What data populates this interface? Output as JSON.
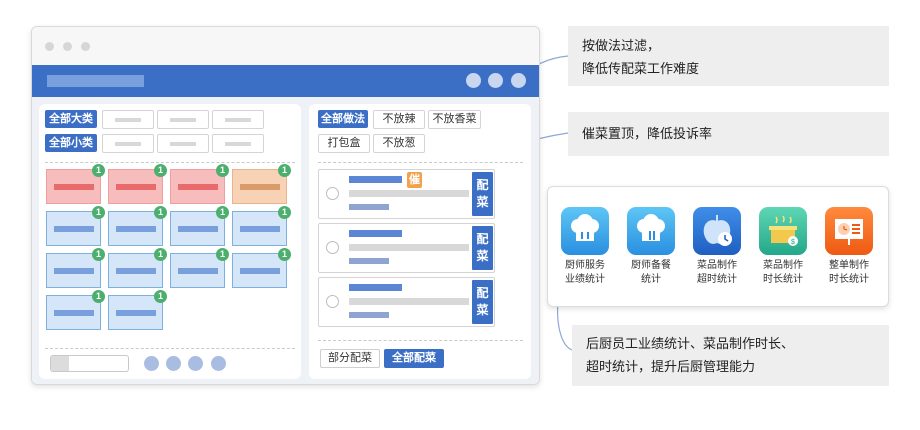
{
  "left_panel": {
    "category_all": "全部大类",
    "subcategory_all": "全部小类",
    "cards": [
      {
        "color": "red",
        "badge": "1"
      },
      {
        "color": "red",
        "badge": "1"
      },
      {
        "color": "red",
        "badge": "1"
      },
      {
        "color": "orange",
        "badge": "1"
      },
      {
        "color": "blue",
        "badge": "1"
      },
      {
        "color": "blue",
        "badge": "1"
      },
      {
        "color": "blue",
        "badge": "1"
      },
      {
        "color": "blue",
        "badge": "1"
      },
      {
        "color": "blue",
        "badge": "1"
      },
      {
        "color": "blue",
        "badge": "1"
      },
      {
        "color": "blue",
        "badge": "1"
      },
      {
        "color": "blue",
        "badge": "1"
      },
      {
        "color": "blue",
        "badge": "1"
      },
      {
        "color": "blue",
        "badge": "1"
      }
    ]
  },
  "right_panel": {
    "methods": [
      "全部做法",
      "不放辣",
      "不放香菜",
      "打包盒",
      "不放葱"
    ],
    "rush_tag": "催",
    "assign_label": "配菜",
    "partial_assign": "部分配菜",
    "assign_all": "全部配菜"
  },
  "callouts": {
    "filter": [
      "按做法过滤，",
      "降低传配菜工作难度"
    ],
    "rush": "催菜置顶，降低投诉率",
    "stats": [
      "后厨员工业绩统计、菜品制作时长、",
      "超时统计，提升后厨管理能力"
    ]
  },
  "stats_items": [
    {
      "icon": "chef-hat-icon",
      "line1": "厨师服务",
      "line2": "业绩统计"
    },
    {
      "icon": "chef-utensils-icon",
      "line1": "厨师备餐",
      "line2": "统计"
    },
    {
      "icon": "apple-clock-icon",
      "line1": "菜品制作",
      "line2": "超时统计"
    },
    {
      "icon": "pot-timer-icon",
      "line1": "菜品制作",
      "line2": "时长统计"
    },
    {
      "icon": "board-clock-icon",
      "line1": "整单制作",
      "line2": "时长统计"
    }
  ],
  "colors": {
    "primary": "#3b6fc6",
    "badge": "#4caf6e",
    "rush": "#f2a24c",
    "card_red": "#f7bcbc",
    "card_orange": "#f7d2b4",
    "card_blue": "#d4e6f7",
    "callout_bg": "#eeeeee"
  }
}
